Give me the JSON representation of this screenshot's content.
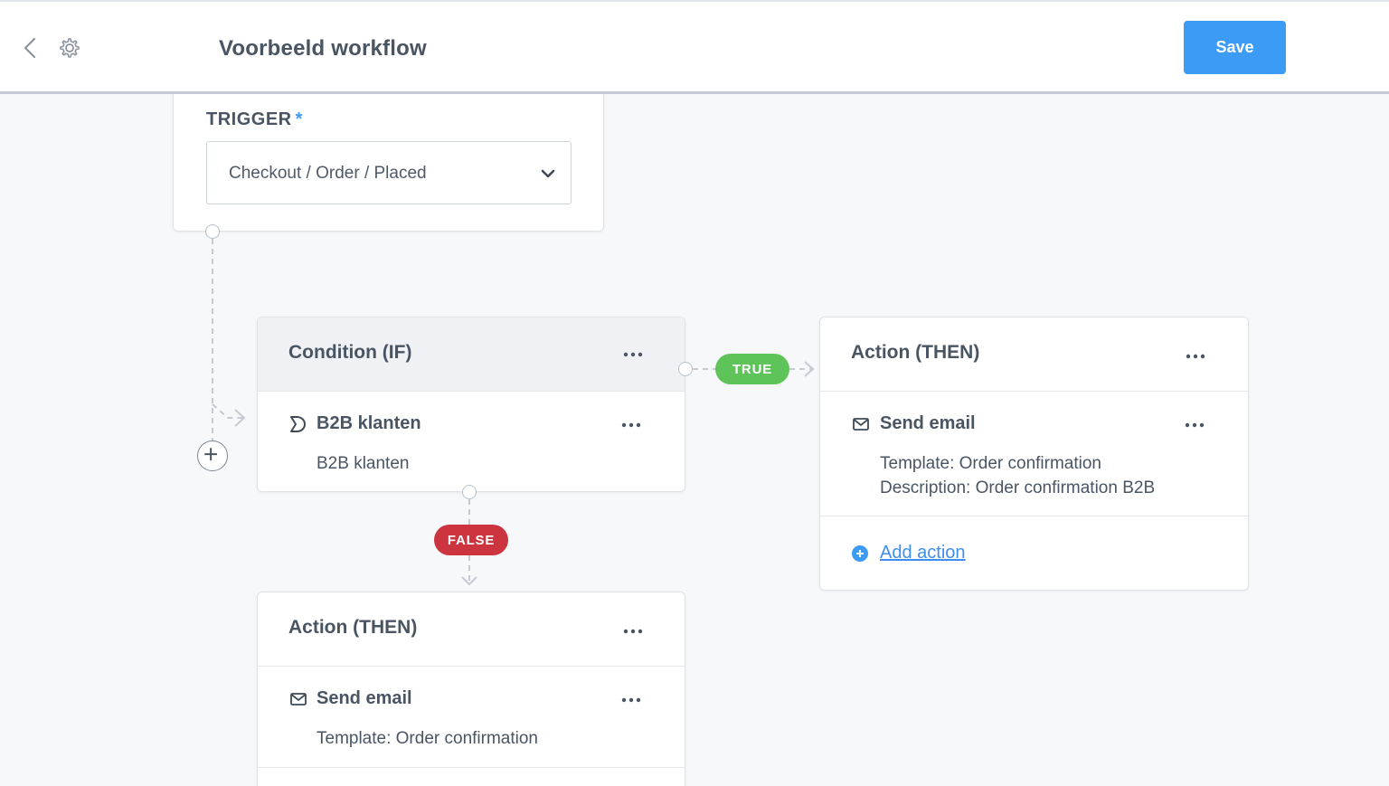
{
  "header": {
    "title": "Voorbeeld workflow",
    "save_label": "Save"
  },
  "trigger": {
    "label": "TRIGGER",
    "required_marker": "*",
    "selected_value": "Checkout / Order / Placed"
  },
  "condition": {
    "title": "Condition (IF)",
    "item_title": "B2B klanten",
    "item_sub": "B2B klanten"
  },
  "branch_labels": {
    "true_label": "TRUE",
    "false_label": "FALSE"
  },
  "action_true": {
    "title": "Action (THEN)",
    "item_title": "Send email",
    "template_line": "Template: Order confirmation",
    "description_line": "Description: Order confirmation B2B",
    "add_action_label": "Add action"
  },
  "action_false": {
    "title": "Action (THEN)",
    "item_title": "Send email",
    "template_line": "Template: Order confirmation"
  },
  "colors": {
    "accent": "#3c9bf5",
    "true_pill": "#5ec45a",
    "false_pill": "#cc3440"
  }
}
